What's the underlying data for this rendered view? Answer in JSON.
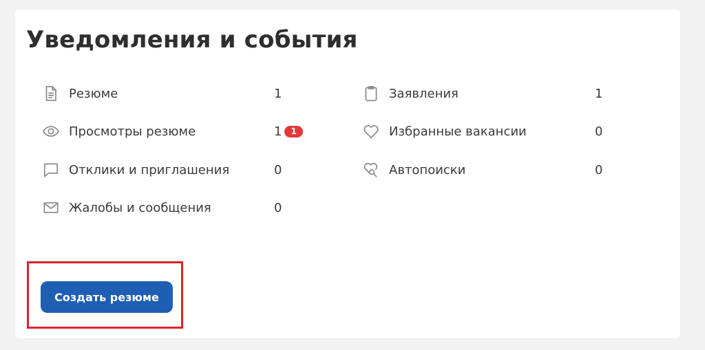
{
  "colors": {
    "page_background": "#f2f2f3",
    "card_background": "#ffffff",
    "icon_stroke": "#8a8c91",
    "badge_red": "#e5383b",
    "button_blue": "#1e5fb4",
    "highlight_red": "#e0202a"
  },
  "panel": {
    "title": "Уведомления и события",
    "left_column": [
      {
        "icon": "document-icon",
        "label": "Резюме",
        "count": "1"
      },
      {
        "icon": "eye-icon",
        "label": "Просмотры резюме",
        "count": "1",
        "badge": "1"
      },
      {
        "icon": "chat-bubble-icon",
        "label": "Отклики и приглашения",
        "count": "0"
      },
      {
        "icon": "envelope-icon",
        "label": "Жалобы и сообщения",
        "count": "0"
      }
    ],
    "right_column": [
      {
        "icon": "clipboard-icon",
        "label": "Заявления",
        "count": "1"
      },
      {
        "icon": "heart-icon",
        "label": "Избранные вакансии",
        "count": "0"
      },
      {
        "icon": "heart-search-icon",
        "label": "Автопоиски",
        "count": "0"
      }
    ],
    "create_button_label": "Создать резюме"
  }
}
